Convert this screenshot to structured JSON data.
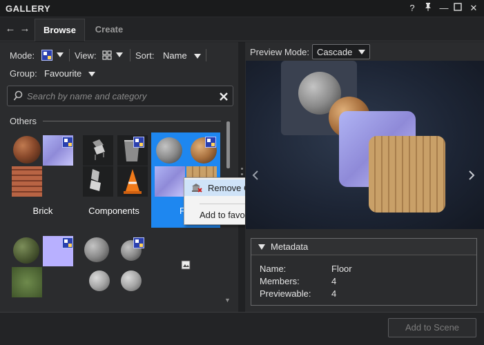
{
  "window": {
    "title": "GALLERY",
    "buttons": {
      "help": "?",
      "pin": "⊥",
      "minimize": "—",
      "maximize": "☐",
      "close": "✕"
    }
  },
  "nav": {
    "back": "←",
    "forward": "→"
  },
  "tabs": [
    {
      "label": "Browse",
      "active": true
    },
    {
      "label": "Create",
      "active": false
    }
  ],
  "toolbar": {
    "mode_label": "Mode:",
    "view_label": "View:",
    "sort_label": "Sort:",
    "sort_value": "Name",
    "group_label": "Group:",
    "group_value": "Favourite"
  },
  "search": {
    "placeholder": "Search by name and category",
    "value": ""
  },
  "section": {
    "label": "Others"
  },
  "tiles": [
    {
      "label": "Brick",
      "selected": false
    },
    {
      "label": "Components",
      "selected": false
    },
    {
      "label": "Flo",
      "selected": true
    },
    {
      "label": "",
      "selected": false
    },
    {
      "label": "",
      "selected": false
    }
  ],
  "context_menu": {
    "items": [
      {
        "label": "Remove Category",
        "icon": "remove-category-icon",
        "highlighted": true
      },
      {
        "label": "Add to favourites",
        "icon": "",
        "highlighted": false
      }
    ]
  },
  "preview": {
    "mode_label": "Preview Mode:",
    "mode_value": "Cascade",
    "prev_icon": "chevron-left-icon",
    "next_icon": "chevron-right-icon"
  },
  "metadata": {
    "title": "Metadata",
    "rows": [
      {
        "key": "Name:",
        "value": "Floor"
      },
      {
        "key": "Members:",
        "value": "4"
      },
      {
        "key": "Previewable:",
        "value": "4"
      }
    ]
  },
  "footer": {
    "add_button": "Add to Scene"
  },
  "colors": {
    "selection": "#1e87f0",
    "menu_highlight": "#cfe3f8",
    "panel_bg": "#2b2c2e"
  }
}
